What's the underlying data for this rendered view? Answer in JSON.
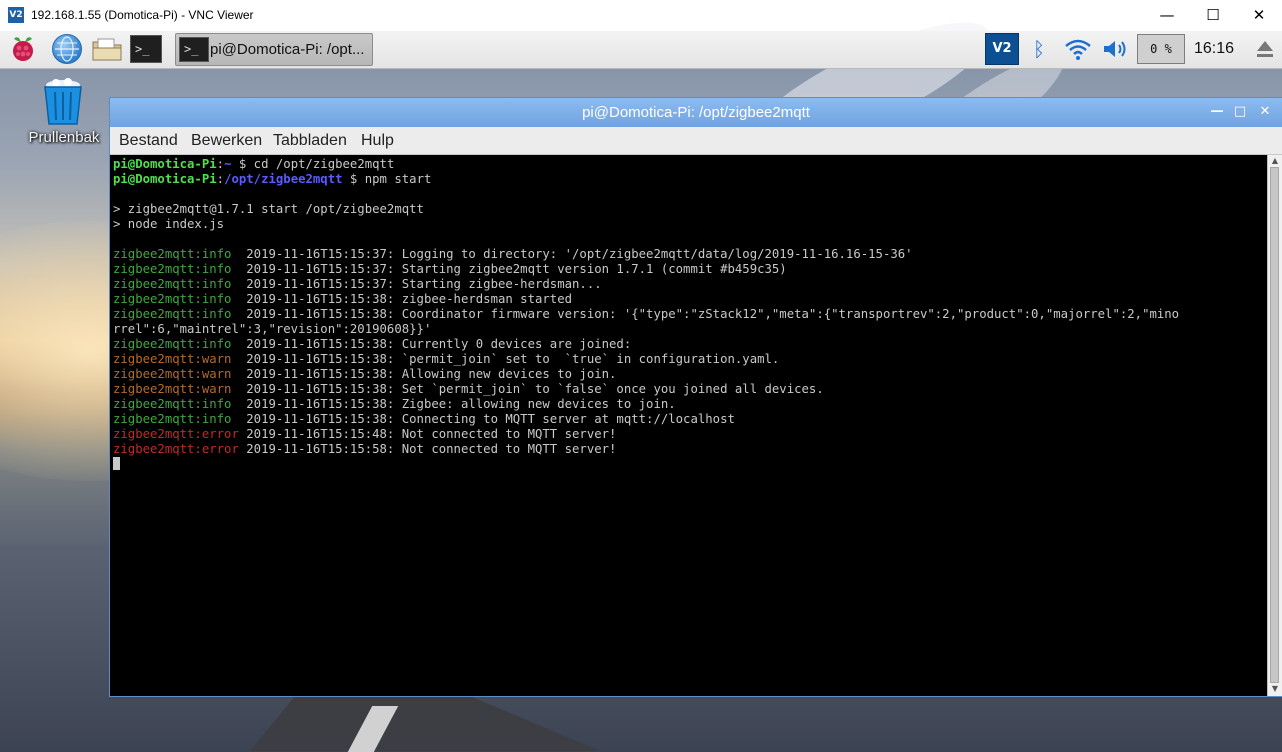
{
  "vnc_window": {
    "icon_text": "V2",
    "title": "192.168.1.55 (Domotica-Pi) - VNC Viewer",
    "minimize": "—",
    "maximize": "☐",
    "close": "✕"
  },
  "panel": {
    "menu_icon": "raspberry-icon",
    "launchers": [
      "web-browser-icon",
      "file-manager-icon",
      "terminal-icon"
    ],
    "terminal_glyph": ">_",
    "task_button": {
      "icon": "terminal-icon",
      "label": "pi@Domotica-Pi: /opt..."
    },
    "vnc_tray": "V2",
    "bluetooth_glyph": "ᛒ",
    "cpu_usage": "0 %",
    "clock": "16:16"
  },
  "desktop": {
    "trash_label": "Prullenbak"
  },
  "terminal": {
    "title": "pi@Domotica-Pi: /opt/zigbee2mqtt",
    "window_buttons": {
      "minimize": "—",
      "maximize": "□",
      "close": "✕"
    },
    "menu": [
      "Bestand",
      "Bewerken",
      "Tabbladen",
      "Hulp"
    ],
    "lines": [
      {
        "segments": [
          {
            "t": "pi@Domotica-Pi",
            "c": "pg"
          },
          {
            "t": ":"
          },
          {
            "t": "~",
            "c": "pb"
          },
          {
            "t": " $ cd /opt/zigbee2mqtt"
          }
        ]
      },
      {
        "segments": [
          {
            "t": "pi@Domotica-Pi",
            "c": "pg"
          },
          {
            "t": ":"
          },
          {
            "t": "/opt/zigbee2mqtt",
            "c": "pb"
          },
          {
            "t": " $ npm start"
          }
        ]
      },
      {
        "segments": [
          {
            "t": ""
          }
        ]
      },
      {
        "segments": [
          {
            "t": "> zigbee2mqtt@1.7.1 start /opt/zigbee2mqtt"
          }
        ]
      },
      {
        "segments": [
          {
            "t": "> node index.js"
          }
        ]
      },
      {
        "segments": [
          {
            "t": ""
          }
        ]
      },
      {
        "segments": [
          {
            "t": "zigbee2mqtt:info ",
            "c": "lgreen"
          },
          {
            "t": " 2019-11-16T15:15:37: Logging to directory: '/opt/zigbee2mqtt/data/log/2019-11-16.16-15-36'"
          }
        ]
      },
      {
        "segments": [
          {
            "t": "zigbee2mqtt:info ",
            "c": "lgreen"
          },
          {
            "t": " 2019-11-16T15:15:37: Starting zigbee2mqtt version 1.7.1 (commit #b459c35)"
          }
        ]
      },
      {
        "segments": [
          {
            "t": "zigbee2mqtt:info ",
            "c": "lgreen"
          },
          {
            "t": " 2019-11-16T15:15:37: Starting zigbee-herdsman..."
          }
        ]
      },
      {
        "segments": [
          {
            "t": "zigbee2mqtt:info ",
            "c": "lgreen"
          },
          {
            "t": " 2019-11-16T15:15:38: zigbee-herdsman started"
          }
        ]
      },
      {
        "segments": [
          {
            "t": "zigbee2mqtt:info ",
            "c": "lgreen"
          },
          {
            "t": " 2019-11-16T15:15:38: Coordinator firmware version: '{\"type\":\"zStack12\",\"meta\":{\"transportrev\":2,\"product\":0,\"majorrel\":2,\"mino"
          }
        ]
      },
      {
        "segments": [
          {
            "t": "rrel\":6,\"maintrel\":3,\"revision\":20190608}}'"
          }
        ]
      },
      {
        "segments": [
          {
            "t": "zigbee2mqtt:info ",
            "c": "lgreen"
          },
          {
            "t": " 2019-11-16T15:15:38: Currently 0 devices are joined:"
          }
        ]
      },
      {
        "segments": [
          {
            "t": "zigbee2mqtt:warn ",
            "c": "lwarn"
          },
          {
            "t": " 2019-11-16T15:15:38: `permit_join` set to  `true` in configuration.yaml."
          }
        ]
      },
      {
        "segments": [
          {
            "t": "zigbee2mqtt:warn ",
            "c": "lwarn"
          },
          {
            "t": " 2019-11-16T15:15:38: Allowing new devices to join."
          }
        ]
      },
      {
        "segments": [
          {
            "t": "zigbee2mqtt:warn ",
            "c": "lwarn"
          },
          {
            "t": " 2019-11-16T15:15:38: Set `permit_join` to `false` once you joined all devices."
          }
        ]
      },
      {
        "segments": [
          {
            "t": "zigbee2mqtt:info ",
            "c": "lgreen"
          },
          {
            "t": " 2019-11-16T15:15:38: Zigbee: allowing new devices to join."
          }
        ]
      },
      {
        "segments": [
          {
            "t": "zigbee2mqtt:info ",
            "c": "lgreen"
          },
          {
            "t": " 2019-11-16T15:15:38: Connecting to MQTT server at mqtt://localhost"
          }
        ]
      },
      {
        "segments": [
          {
            "t": "zigbee2mqtt:error",
            "c": "lerr"
          },
          {
            "t": " 2019-11-16T15:15:48: Not connected to MQTT server!"
          }
        ]
      },
      {
        "segments": [
          {
            "t": "zigbee2mqtt:error",
            "c": "lerr"
          },
          {
            "t": " 2019-11-16T15:15:58: Not connected to MQTT server!"
          }
        ]
      }
    ]
  }
}
